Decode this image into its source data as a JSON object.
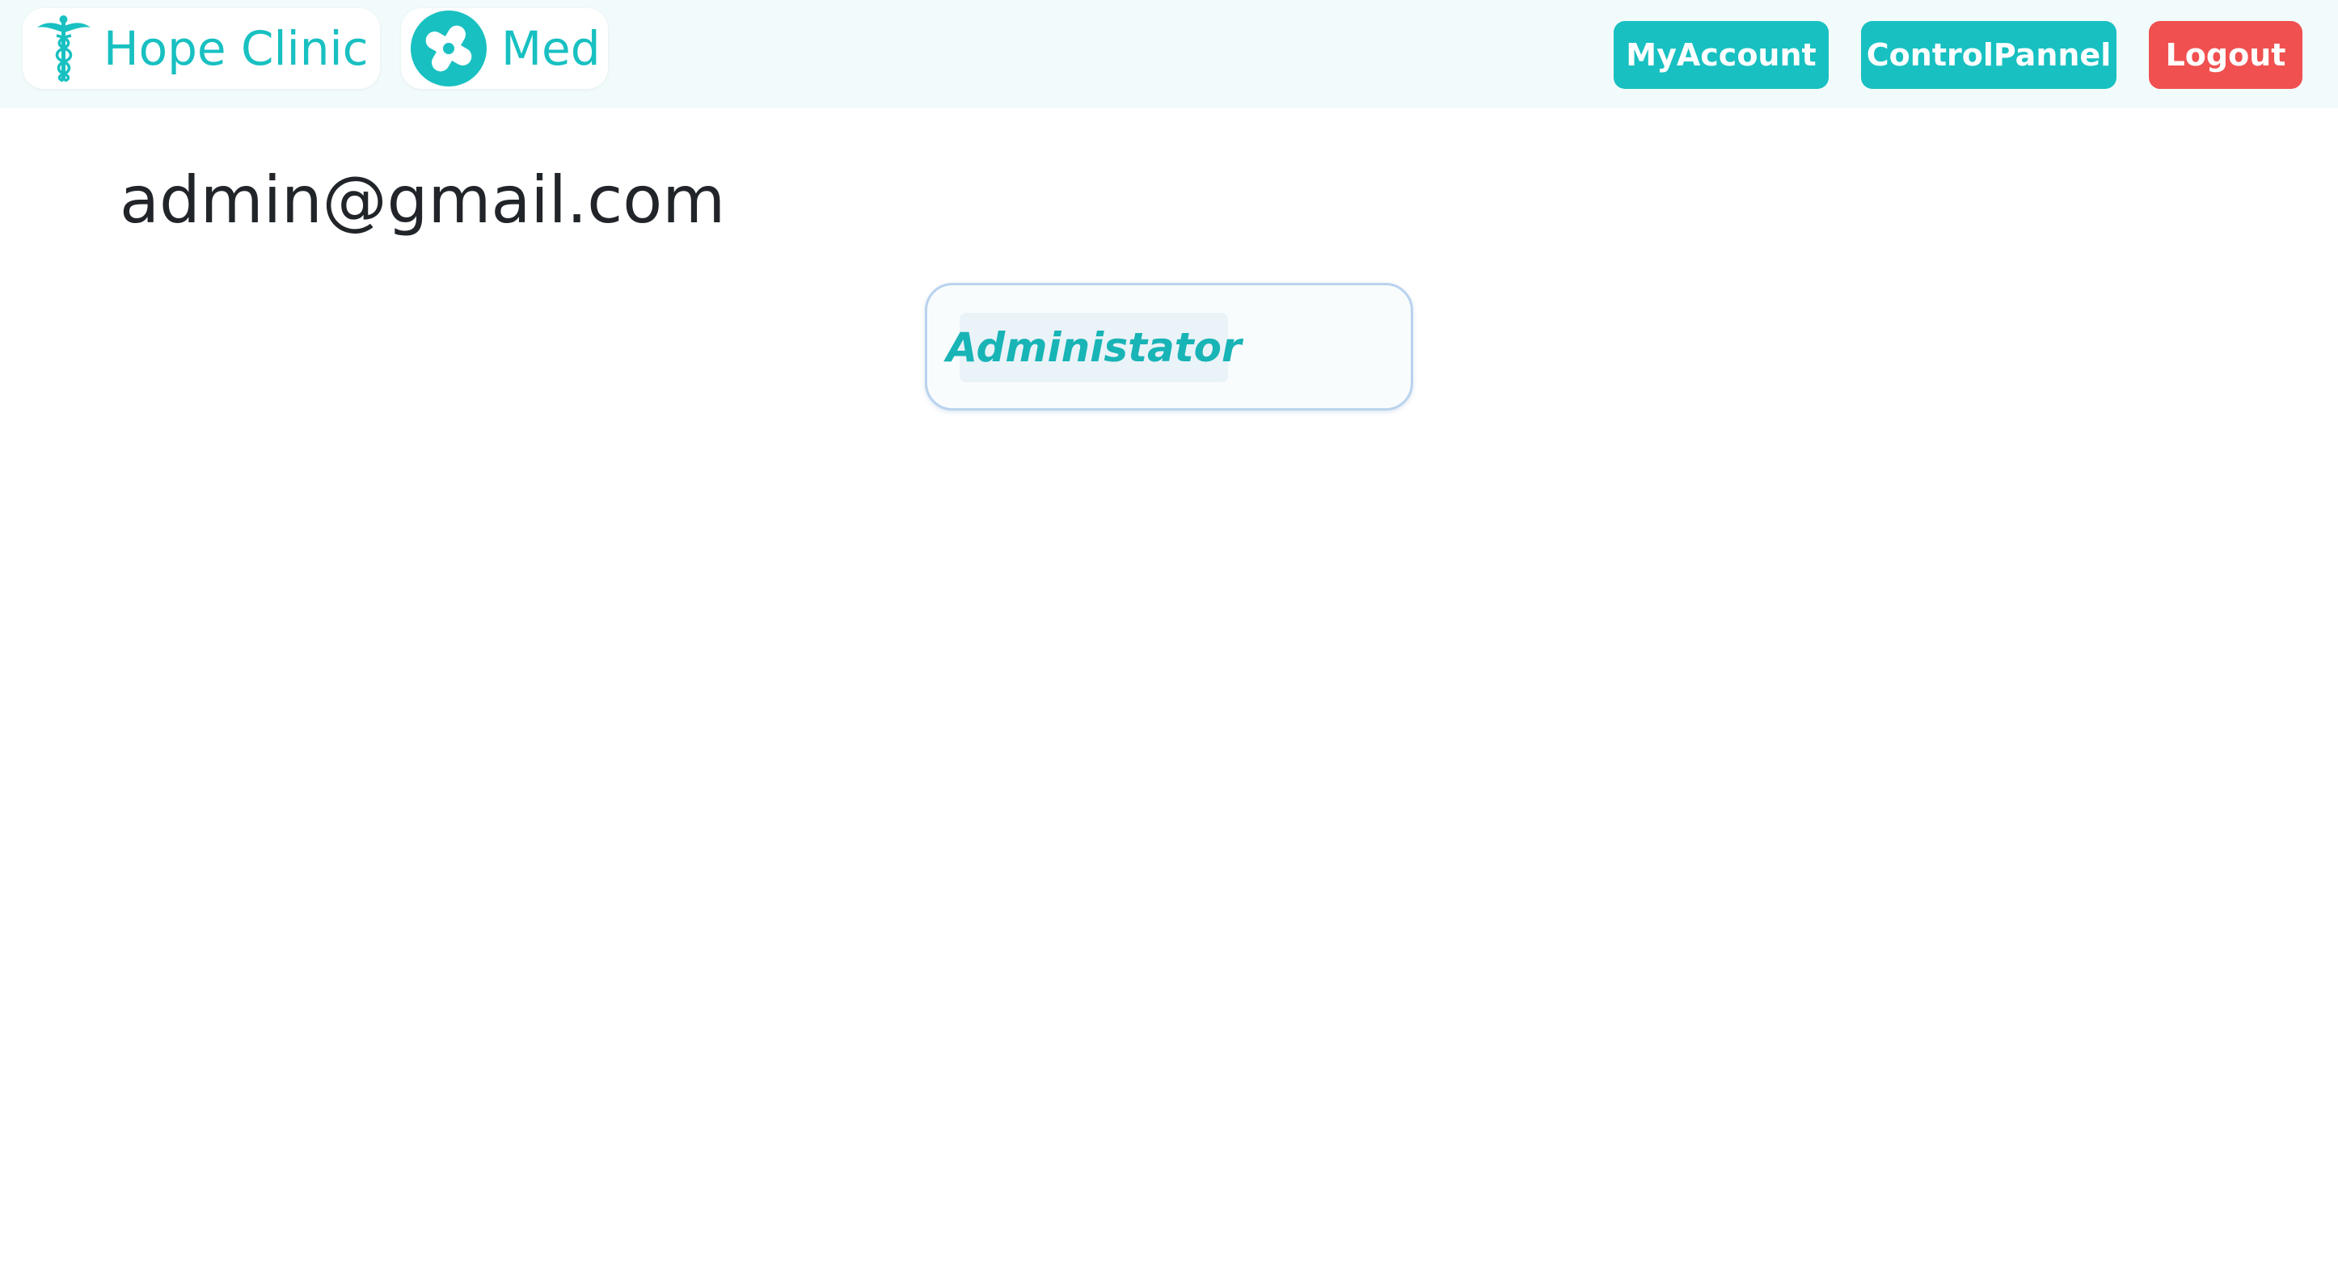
{
  "header": {
    "brand_primary": "Hope Clinic",
    "brand_secondary": "Med",
    "icons": [
      "caduceus-icon",
      "medical-cross-icon"
    ],
    "buttons": {
      "my_account": "MyAccount",
      "control_panel": "ControlPannel",
      "logout": "Logout"
    }
  },
  "profile": {
    "email": "admin@gmail.com",
    "role": "Administator"
  },
  "colors": {
    "accent": "#18c0c1",
    "danger": "#f05050",
    "header_bg": "#f2fbfb",
    "text": "#212529"
  }
}
